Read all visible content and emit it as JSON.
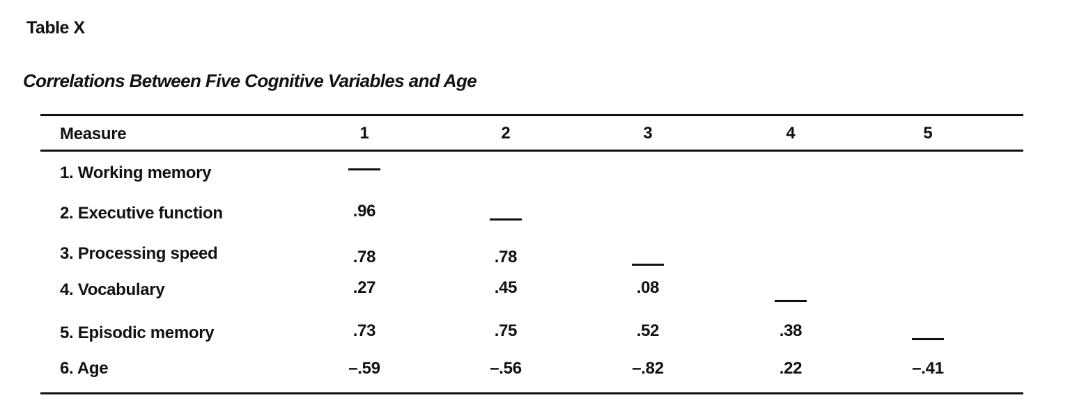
{
  "table": {
    "label": "Table X",
    "title": "Correlations Between Five Cognitive Variables and Age",
    "header": {
      "measure": "Measure",
      "columns": [
        "1",
        "2",
        "3",
        "4",
        "5"
      ]
    },
    "rows": [
      {
        "label": "1. Working memory",
        "cells": [
          "—",
          "",
          "",
          "",
          ""
        ]
      },
      {
        "label": "2. Executive function",
        "cells": [
          ".96",
          "—",
          "",
          "",
          ""
        ]
      },
      {
        "label": "3. Processing speed",
        "cells": [
          ".78",
          ".78",
          "—",
          "",
          ""
        ]
      },
      {
        "label": "4. Vocabulary",
        "cells": [
          ".27",
          ".45",
          ".08",
          "—",
          ""
        ]
      },
      {
        "label": "5. Episodic memory",
        "cells": [
          ".73",
          ".75",
          ".52",
          ".38",
          "—"
        ]
      },
      {
        "label": "6. Age",
        "cells": [
          "–.59",
          "–.56",
          "–.82",
          ".22",
          "–.41"
        ]
      }
    ]
  }
}
